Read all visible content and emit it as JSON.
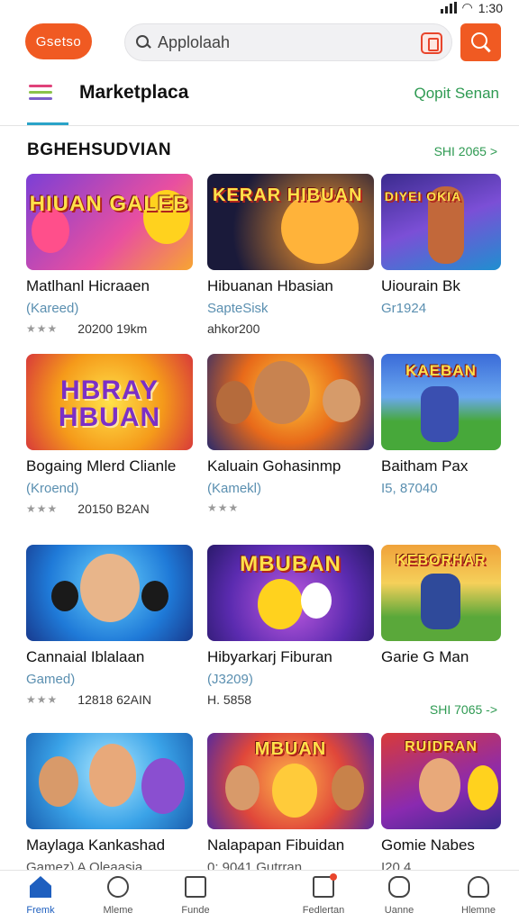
{
  "status_bar": {
    "time": "1:30"
  },
  "header": {
    "logo_label": "Gsetso",
    "search_placeholder": "Applolaah"
  },
  "tabs": {
    "title": "Marketplaca",
    "right_link": "Qopit Senan"
  },
  "section": {
    "title": "BGHEHSUDVIAN",
    "more_1": "SHI 2065 >",
    "more_2": "SHI 7065 ->"
  },
  "cards": [
    {
      "thumb_text": "HIUAN GALEB",
      "name": "Matlhanl Hicraaen",
      "sub": "(Kareed)",
      "meta": "20200 19km",
      "stars": "★★★"
    },
    {
      "thumb_text": "KERAR HIBUAN",
      "name": "Hibuanan Hbasian",
      "sub": "SapteSisk",
      "meta": "ahkor200",
      "stars": ""
    },
    {
      "thumb_text": "DIYEI OKIA",
      "name": "Uiourain Bk",
      "sub": "Gr1924",
      "meta": "",
      "stars": ""
    },
    {
      "thumb_text": "HBRAY HBUAN",
      "name": "Bogaing Mlerd Clianle",
      "sub": "(Kroend)",
      "meta": "20150 B2AN",
      "stars": "★★★"
    },
    {
      "thumb_text": "",
      "name": "Kaluain Gohasinmp",
      "sub": "(Kamekl)",
      "meta": "",
      "stars": "★★★"
    },
    {
      "thumb_text": "KAEBAN",
      "name": "Baitham Pax",
      "sub": "I5, 87040",
      "meta": "",
      "stars": ""
    },
    {
      "thumb_text": "",
      "name": "Cannaial Iblalaan",
      "sub": "Gamed)",
      "meta": "12818 62AIN",
      "stars": "★★★"
    },
    {
      "thumb_text": "MBUBAN",
      "name": "Hibyarkarj Fiburan",
      "sub": "(J3209)",
      "meta": "H. 5858",
      "stars": ""
    },
    {
      "thumb_text": "KEBORHAR",
      "name": "Garie G Man",
      "sub": "",
      "meta": "",
      "stars": ""
    },
    {
      "thumb_text": "",
      "name": "Maylaga Kankashad",
      "sub": "Gamez) A Oleaasia",
      "meta": "",
      "stars": ""
    },
    {
      "thumb_text": "MBUAN",
      "name": "Nalapapan Fibuidan",
      "sub": "0: 9041 Gutrran",
      "meta": "",
      "stars": ""
    },
    {
      "thumb_text": "RUIDRAN",
      "name": "Gomie Nabes",
      "sub": "I20 4",
      "meta": "",
      "stars": ""
    }
  ],
  "nav": [
    {
      "label": "Fremk",
      "icon": "home-icon"
    },
    {
      "label": "Mleme",
      "icon": "clock-icon"
    },
    {
      "label": "Funde",
      "icon": "grid-icon"
    },
    {
      "label": "Fedlertan",
      "icon": "document-icon"
    },
    {
      "label": "Uanne",
      "icon": "chat-icon"
    },
    {
      "label": "Hlemne",
      "icon": "profile-icon"
    }
  ]
}
